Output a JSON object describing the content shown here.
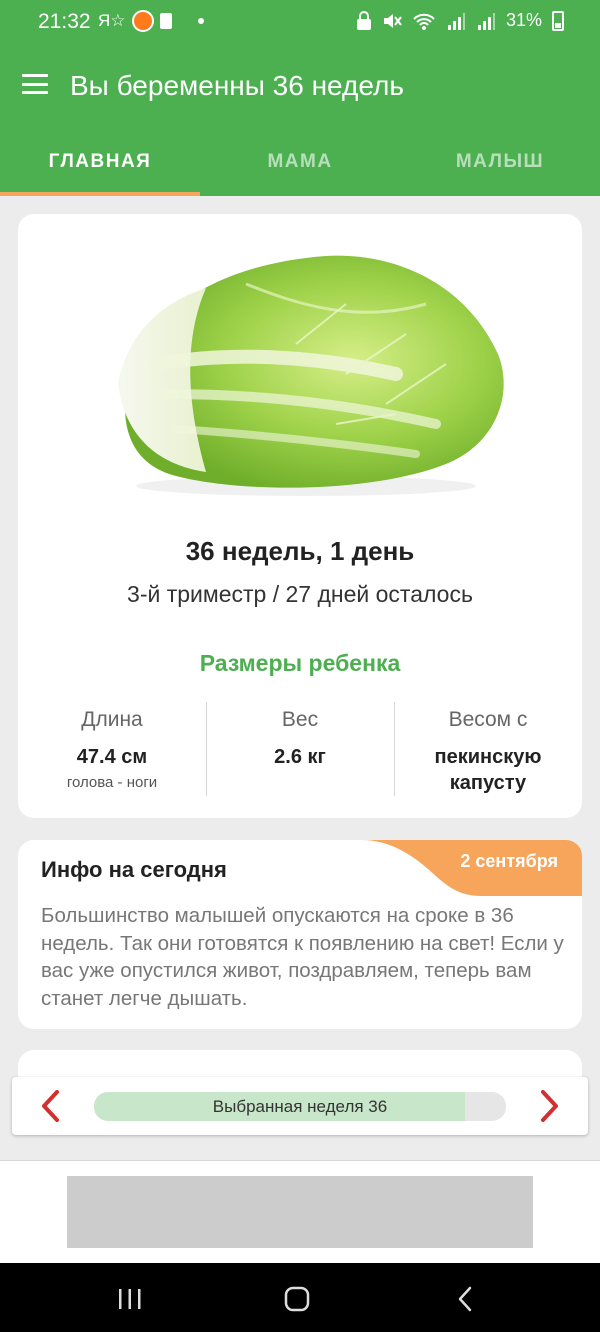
{
  "status_bar": {
    "time": "21:32",
    "left_text": "Я☆",
    "battery": "31%"
  },
  "app_bar": {
    "title": "Вы беременны 36 недель"
  },
  "tabs": [
    {
      "label": "ГЛАВНАЯ",
      "active": true
    },
    {
      "label": "МАМА",
      "active": false
    },
    {
      "label": "МАЛЫШ",
      "active": false
    }
  ],
  "week_card": {
    "illustration": "napa-cabbage-image",
    "title": "36 недель, 1 день",
    "subtitle": "3-й триместр / 27 дней осталось",
    "sizes_heading": "Размеры ребенка",
    "stats": [
      {
        "label": "Длина",
        "value": "47.4 см",
        "note": "голова - ноги"
      },
      {
        "label": "Вес",
        "value": "2.6 кг",
        "note": ""
      },
      {
        "label": "Весом с",
        "value": "пекинскую капусту",
        "note": ""
      }
    ]
  },
  "info_card": {
    "title": "Инфо на сегодня",
    "date": "2 сентября",
    "text": "Большинство малышей опускаются на сроке в 36 недель. Так они готовятся к появлению на свет! Если у вас уже опустился живот, поздравляем, теперь вам станет легче дышать."
  },
  "week_selector": {
    "label": "Выбранная неделя 36",
    "progress_fraction": 0.9
  },
  "colors": {
    "primary": "#4caf50",
    "accent": "#f6a55a",
    "arrow": "#d32f2f",
    "progress_fill": "#c8e6c9"
  },
  "icons": {
    "menu": "hamburger-icon",
    "prev": "chevron-left-icon",
    "next": "chevron-right-icon",
    "nav_recent": "recent-apps-icon",
    "nav_home": "home-icon",
    "nav_back": "back-icon"
  }
}
